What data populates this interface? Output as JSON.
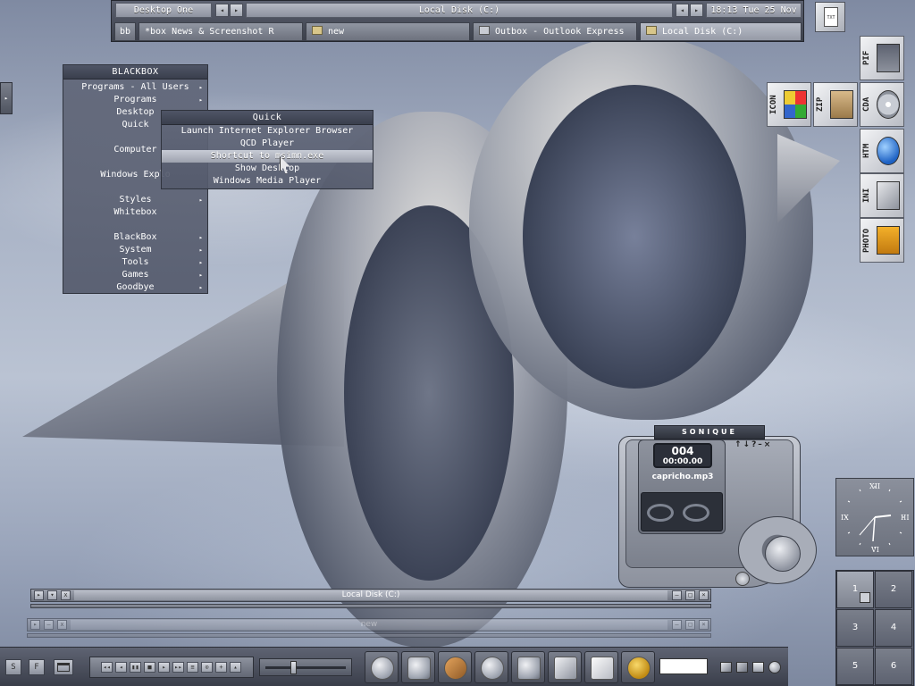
{
  "toolbar": {
    "workspace_label": "Desktop One",
    "window_label": "Local Disk (C:)",
    "clock": "18:13 Tue 25 Nov",
    "bb_label": "bb"
  },
  "tasks": [
    {
      "label": "*box News & Screenshot R",
      "icon": "none"
    },
    {
      "label": "new",
      "icon": "folder-icon"
    },
    {
      "label": "Outbox - Outlook Express",
      "icon": "outlook-icon"
    },
    {
      "label": "Local Disk (C:)",
      "icon": "folder-icon"
    }
  ],
  "main_menu": {
    "title": "BLACKBOX",
    "items": [
      {
        "label": "Programs - All Users",
        "sub": true
      },
      {
        "label": "Programs",
        "sub": true
      },
      {
        "label": "Desktop",
        "sub": false
      },
      {
        "label": "Quick",
        "sub": false
      },
      {
        "label": "",
        "sub": false
      },
      {
        "label": "Computer",
        "sub": false
      },
      {
        "label": "",
        "sub": false
      },
      {
        "label": "Windows Explo",
        "sub": false
      },
      {
        "label": "",
        "sub": false
      },
      {
        "label": "Styles",
        "sub": true
      },
      {
        "label": "Whitebox",
        "sub": false
      },
      {
        "label": "",
        "sub": false
      },
      {
        "label": "BlackBox",
        "sub": true
      },
      {
        "label": "System",
        "sub": true
      },
      {
        "label": "Tools",
        "sub": true
      },
      {
        "label": "Games",
        "sub": true
      },
      {
        "label": "Goodbye",
        "sub": true
      }
    ]
  },
  "quick_menu": {
    "title": "Quick",
    "items": [
      "Launch Internet Explorer Browser",
      "QCD Player",
      "Shortcut to msimn.exe",
      "Show Desktop",
      "Windows Media Player"
    ],
    "selected_index": 2
  },
  "desktop_icons": [
    {
      "label": "PIF",
      "icon": "pif-icon"
    },
    {
      "label": "ICON",
      "icon": "icon-file-icon"
    },
    {
      "label": "ZIP",
      "icon": "zip-icon"
    },
    {
      "label": "CDA",
      "icon": "cda-icon"
    },
    {
      "label": "HTM",
      "icon": "htm-icon"
    },
    {
      "label": "INI",
      "icon": "ini-icon"
    },
    {
      "label": "PHOTO",
      "icon": "photo-icon"
    }
  ],
  "windows": [
    {
      "title": "Local Disk (C:)"
    },
    {
      "title": "new"
    }
  ],
  "sonique": {
    "brand": "SONIQUE",
    "track_number": "004",
    "time": "00:00.00",
    "filename": "capricho.mp3",
    "controls": "↑↓?–×"
  },
  "clock_numerals": {
    "top": "XII",
    "right": "III",
    "bottom": "VI",
    "left": "IX"
  },
  "pager": [
    "1",
    "2",
    "3",
    "4",
    "5",
    "6"
  ],
  "bottom": {
    "left_btn_1": "S",
    "left_btn_2": "F",
    "media_buttons": [
      "◂◂",
      "◂",
      "▮▮",
      "■",
      "▸",
      "▸▸",
      "≡",
      "⊙",
      "+",
      "▴"
    ],
    "tray_icons": [
      "network-icon",
      "window-icon",
      "minus-icon",
      "globe-icon"
    ]
  },
  "colors": {
    "bar_dark": "#3c404b",
    "menu_bg": "#5e6478",
    "highlight": "#b9bdc8"
  }
}
